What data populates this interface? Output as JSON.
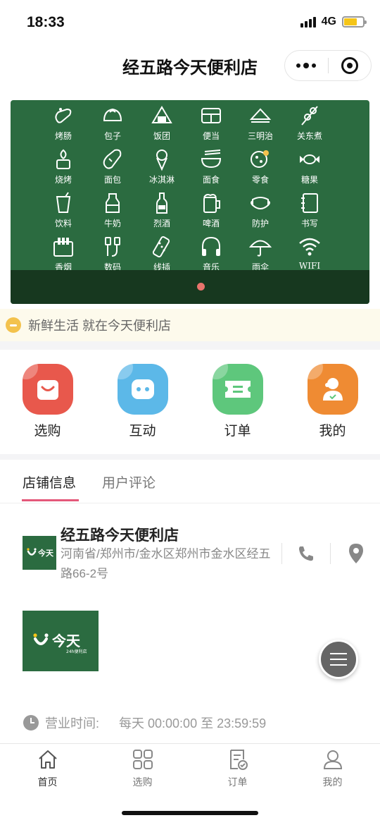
{
  "status_bar": {
    "time": "18:33",
    "network": "4G",
    "battery_color": "#f5c518"
  },
  "nav": {
    "title": "经五路今天便利店"
  },
  "banner": {
    "background": "#2b6b40",
    "categories": [
      {
        "label": "烤肠",
        "icon": "sausage-icon"
      },
      {
        "label": "包子",
        "icon": "bun-icon"
      },
      {
        "label": "饭团",
        "icon": "rice-ball-icon"
      },
      {
        "label": "便当",
        "icon": "bento-icon"
      },
      {
        "label": "三明治",
        "icon": "sandwich-icon"
      },
      {
        "label": "关东煮",
        "icon": "skewer-icon"
      },
      {
        "label": "烧烤",
        "icon": "bbq-icon"
      },
      {
        "label": "面包",
        "icon": "bread-icon"
      },
      {
        "label": "冰淇淋",
        "icon": "ice-cream-icon"
      },
      {
        "label": "面食",
        "icon": "noodle-icon"
      },
      {
        "label": "零食",
        "icon": "cookie-icon"
      },
      {
        "label": "糖果",
        "icon": "candy-icon"
      },
      {
        "label": "饮料",
        "icon": "drink-icon"
      },
      {
        "label": "牛奶",
        "icon": "milk-icon"
      },
      {
        "label": "烈酒",
        "icon": "liquor-icon"
      },
      {
        "label": "啤酒",
        "icon": "beer-icon"
      },
      {
        "label": "防护",
        "icon": "mask-icon"
      },
      {
        "label": "书写",
        "icon": "notebook-icon"
      },
      {
        "label": "香烟",
        "icon": "cigarette-icon"
      },
      {
        "label": "数码",
        "icon": "cable-icon"
      },
      {
        "label": "线插",
        "icon": "power-strip-icon"
      },
      {
        "label": "音乐",
        "icon": "headphones-icon"
      },
      {
        "label": "雨伞",
        "icon": "umbrella-icon"
      },
      {
        "label": "WIFI",
        "icon": "wifi-icon"
      }
    ]
  },
  "notice": {
    "text": "新鲜生活 就在今天便利店"
  },
  "menu": [
    {
      "label": "选购",
      "color": "#e8584c",
      "icon": "shopping-bag-icon"
    },
    {
      "label": "互动",
      "color": "#5cb8e8",
      "icon": "chat-icon"
    },
    {
      "label": "订单",
      "color": "#5ec77c",
      "icon": "ticket-icon"
    },
    {
      "label": "我的",
      "color": "#ef8b33",
      "icon": "profile-icon"
    }
  ],
  "tabs": {
    "store_info": "店铺信息",
    "reviews": "用户评论",
    "accent": "#e4587a"
  },
  "store": {
    "name": "经五路今天便利店",
    "address": "河南省/郑州市/金水区郑州市金水区经五路66-2号",
    "logo_text": "今天",
    "logo_sub": "24h便利店",
    "hours_label": "营业时间:",
    "hours_value": "每天 00:00:00 至 23:59:59"
  },
  "tabbar": [
    {
      "label": "首页",
      "icon": "home-icon",
      "active": true
    },
    {
      "label": "选购",
      "icon": "grid-icon",
      "active": false
    },
    {
      "label": "订单",
      "icon": "order-icon",
      "active": false
    },
    {
      "label": "我的",
      "icon": "user-icon",
      "active": false
    }
  ]
}
